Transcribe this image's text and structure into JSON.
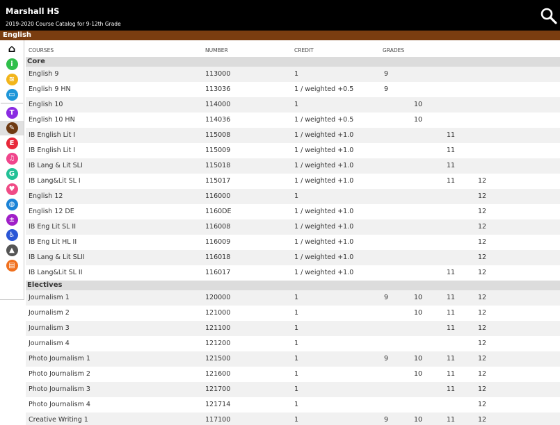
{
  "header": {
    "title": "Marshall HS",
    "subtitle": "2019-2020 Course Catalog for 9-12th Grade",
    "search_icon": "search-icon"
  },
  "section": {
    "title": "English",
    "color": "#7a3d10"
  },
  "sidebar": {
    "items": [
      {
        "name": "home-icon",
        "color": "#000000",
        "glyph": "⌂",
        "active": false
      },
      {
        "name": "info-icon",
        "color": "#2fbf4a",
        "glyph": "i",
        "active": false
      },
      {
        "name": "graduation-cap-icon",
        "color": "#f2b51b",
        "glyph": "≋",
        "active": false
      },
      {
        "name": "book-icon",
        "color": "#1e96d8",
        "glyph": "▭",
        "active": false
      },
      {
        "name": "translation-icon",
        "color": "#8a2be2",
        "glyph": "T",
        "active": false
      },
      {
        "name": "pen-nib-icon",
        "color": "#6e3a12",
        "glyph": "✎",
        "active": true
      },
      {
        "name": "english-e-icon",
        "color": "#e8283a",
        "glyph": "E",
        "active": false
      },
      {
        "name": "music-icon",
        "color": "#f0458c",
        "glyph": "♫",
        "active": false
      },
      {
        "name": "grammar-g-icon",
        "color": "#22c196",
        "glyph": "G",
        "active": false
      },
      {
        "name": "heartbeat-icon",
        "color": "#f04b86",
        "glyph": "♥",
        "active": false
      },
      {
        "name": "globe-icon",
        "color": "#1a82d6",
        "glyph": "◍",
        "active": false
      },
      {
        "name": "math-symbols-icon",
        "color": "#a01fc8",
        "glyph": "±",
        "active": false
      },
      {
        "name": "accessibility-icon",
        "color": "#2a56d6",
        "glyph": "♿",
        "active": false
      },
      {
        "name": "career-icon",
        "color": "#555555",
        "glyph": "▲",
        "active": false
      },
      {
        "name": "courses-icon",
        "color": "#f0701e",
        "glyph": "▤",
        "active": false
      }
    ]
  },
  "table": {
    "headers": {
      "courses": "COURSES",
      "number": "NUMBER",
      "credit": "CREDIT",
      "grades": "GRADES"
    },
    "groups": [
      {
        "title": "Core",
        "rows": [
          {
            "name": "English 9",
            "number": "113000",
            "credit": "1",
            "g9": "9",
            "g10": "",
            "g11": "",
            "g12": ""
          },
          {
            "name": "English 9 HN",
            "number": "113036",
            "credit": "1 / weighted +0.5",
            "g9": "9",
            "g10": "",
            "g11": "",
            "g12": ""
          },
          {
            "name": "English 10",
            "number": "114000",
            "credit": "1",
            "g9": "",
            "g10": "10",
            "g11": "",
            "g12": ""
          },
          {
            "name": "English 10 HN",
            "number": "114036",
            "credit": "1 / weighted +0.5",
            "g9": "",
            "g10": "10",
            "g11": "",
            "g12": ""
          },
          {
            "name": "IB English Lit I",
            "number": "115008",
            "credit": "1 / weighted +1.0",
            "g9": "",
            "g10": "",
            "g11": "11",
            "g12": ""
          },
          {
            "name": "IB English Lit I",
            "number": "115009",
            "credit": "1 / weighted +1.0",
            "g9": "",
            "g10": "",
            "g11": "11",
            "g12": ""
          },
          {
            "name": "IB Lang & Lit SLI",
            "number": "115018",
            "credit": "1 / weighted +1.0",
            "g9": "",
            "g10": "",
            "g11": "11",
            "g12": ""
          },
          {
            "name": "IB Lang&Lit SL I",
            "number": "115017",
            "credit": "1 / weighted +1.0",
            "g9": "",
            "g10": "",
            "g11": "11",
            "g12": "12"
          },
          {
            "name": "English 12",
            "number": "116000",
            "credit": "1",
            "g9": "",
            "g10": "",
            "g11": "",
            "g12": "12"
          },
          {
            "name": "English 12 DE",
            "number": "1160DE",
            "credit": "1 / weighted +1.0",
            "g9": "",
            "g10": "",
            "g11": "",
            "g12": "12"
          },
          {
            "name": "IB Eng Lit SL II",
            "number": "116008",
            "credit": "1 / weighted +1.0",
            "g9": "",
            "g10": "",
            "g11": "",
            "g12": "12"
          },
          {
            "name": "IB Eng Lit HL II",
            "number": "116009",
            "credit": "1 / weighted +1.0",
            "g9": "",
            "g10": "",
            "g11": "",
            "g12": "12"
          },
          {
            "name": "IB Lang & Lit SLII",
            "number": "116018",
            "credit": "1 / weighted +1.0",
            "g9": "",
            "g10": "",
            "g11": "",
            "g12": "12"
          },
          {
            "name": "IB Lang&Lit SL II",
            "number": "116017",
            "credit": "1 / weighted +1.0",
            "g9": "",
            "g10": "",
            "g11": "11",
            "g12": "12"
          }
        ]
      },
      {
        "title": "Electives",
        "rows": [
          {
            "name": "Journalism 1",
            "number": "120000",
            "credit": "1",
            "g9": "9",
            "g10": "10",
            "g11": "11",
            "g12": "12"
          },
          {
            "name": "Journalism 2",
            "number": "121000",
            "credit": "1",
            "g9": "",
            "g10": "10",
            "g11": "11",
            "g12": "12"
          },
          {
            "name": "Journalism 3",
            "number": "121100",
            "credit": "1",
            "g9": "",
            "g10": "",
            "g11": "11",
            "g12": "12"
          },
          {
            "name": "Journalism 4",
            "number": "121200",
            "credit": "1",
            "g9": "",
            "g10": "",
            "g11": "",
            "g12": "12"
          },
          {
            "name": "Photo Journalism 1",
            "number": "121500",
            "credit": "1",
            "g9": "9",
            "g10": "10",
            "g11": "11",
            "g12": "12"
          },
          {
            "name": "Photo Journalism 2",
            "number": "121600",
            "credit": "1",
            "g9": "",
            "g10": "10",
            "g11": "11",
            "g12": "12"
          },
          {
            "name": "Photo Journalism 3",
            "number": "121700",
            "credit": "1",
            "g9": "",
            "g10": "",
            "g11": "11",
            "g12": "12"
          },
          {
            "name": "Photo Journalism 4",
            "number": "121714",
            "credit": "1",
            "g9": "",
            "g10": "",
            "g11": "",
            "g12": "12"
          },
          {
            "name": "Creative Writing 1",
            "number": "117100",
            "credit": "1",
            "g9": "9",
            "g10": "10",
            "g11": "11",
            "g12": "12"
          }
        ]
      }
    ]
  }
}
